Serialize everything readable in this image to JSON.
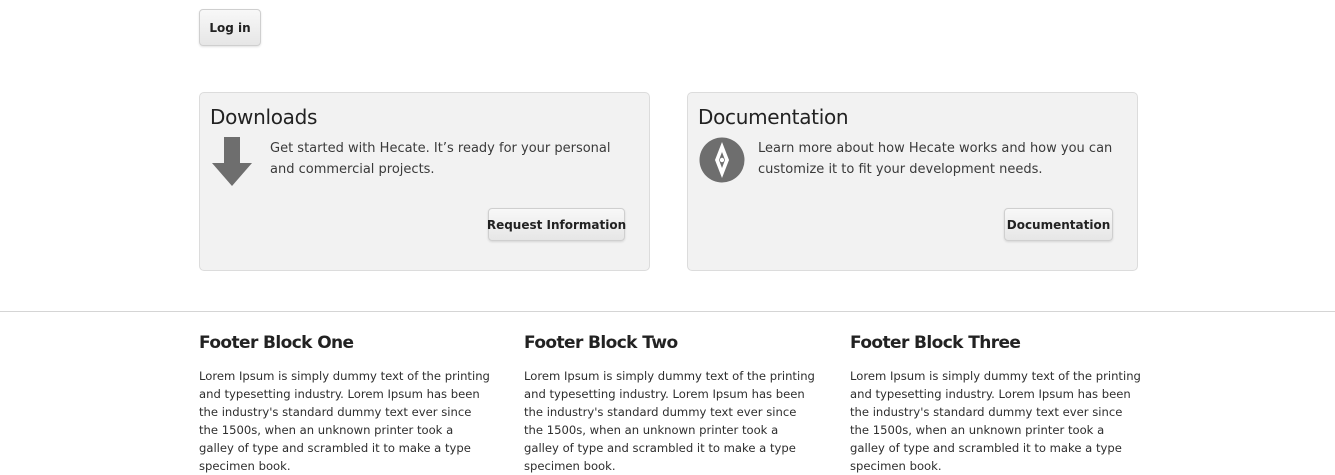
{
  "header": {
    "login_label": "Log in"
  },
  "panels": [
    {
      "title": "Downloads",
      "icon": "download-arrow-icon",
      "text": "Get started with Hecate. It’s ready for your personal and commercial projects.",
      "button_label": "Request Information"
    },
    {
      "title": "Documentation",
      "icon": "compass-icon",
      "text": "Learn more about how Hecate works and how you can customize it to fit your development needs.",
      "button_label": "Documentation"
    }
  ],
  "footer": {
    "blocks": [
      {
        "title": "Footer Block One",
        "text": "Lorem Ipsum is simply dummy text of the printing and typesetting industry. Lorem Ipsum has been the industry's standard dummy text ever since the 1500s, when an unknown printer took a galley of type and scrambled it to make a type specimen book."
      },
      {
        "title": "Footer Block Two",
        "text": "Lorem Ipsum is simply dummy text of the printing and typesetting industry. Lorem Ipsum has been the industry's standard dummy text ever since the 1500s, when an unknown printer took a galley of type and scrambled it to make a type specimen book."
      },
      {
        "title": "Footer Block Three",
        "text": "Lorem Ipsum is simply dummy text of the printing and typesetting industry. Lorem Ipsum has been the industry's standard dummy text ever since the 1500s, when an unknown printer took a galley of type and scrambled it to make a type specimen book."
      }
    ]
  },
  "colors": {
    "panel_background": "#f2f2f2",
    "icon_gray": "#6e6e6e",
    "divider": "#d5d5d5"
  }
}
